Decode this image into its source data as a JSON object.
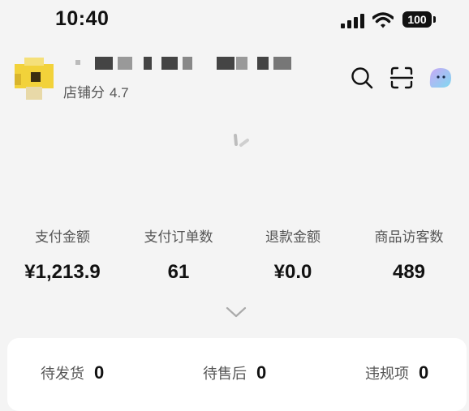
{
  "status_bar": {
    "time": "10:40",
    "battery": "100"
  },
  "store": {
    "score_label": "店铺分",
    "score_value": "4.7"
  },
  "header": {
    "icons": [
      "search-icon",
      "scan-icon",
      "assistant-icon"
    ]
  },
  "metrics": [
    {
      "label": "支付金额",
      "value": "¥1,213.9"
    },
    {
      "label": "支付订单数",
      "value": "61"
    },
    {
      "label": "退款金额",
      "value": "¥0.0"
    },
    {
      "label": "商品访客数",
      "value": "489"
    }
  ],
  "todos": [
    {
      "label": "待发货",
      "value": "0"
    },
    {
      "label": "待售后",
      "value": "0"
    },
    {
      "label": "违规项",
      "value": "0"
    }
  ],
  "colors": {
    "background": "#f4f4f4",
    "card": "#ffffff",
    "avatar": "#f2d23a",
    "assistant": "#8fd4f2"
  }
}
